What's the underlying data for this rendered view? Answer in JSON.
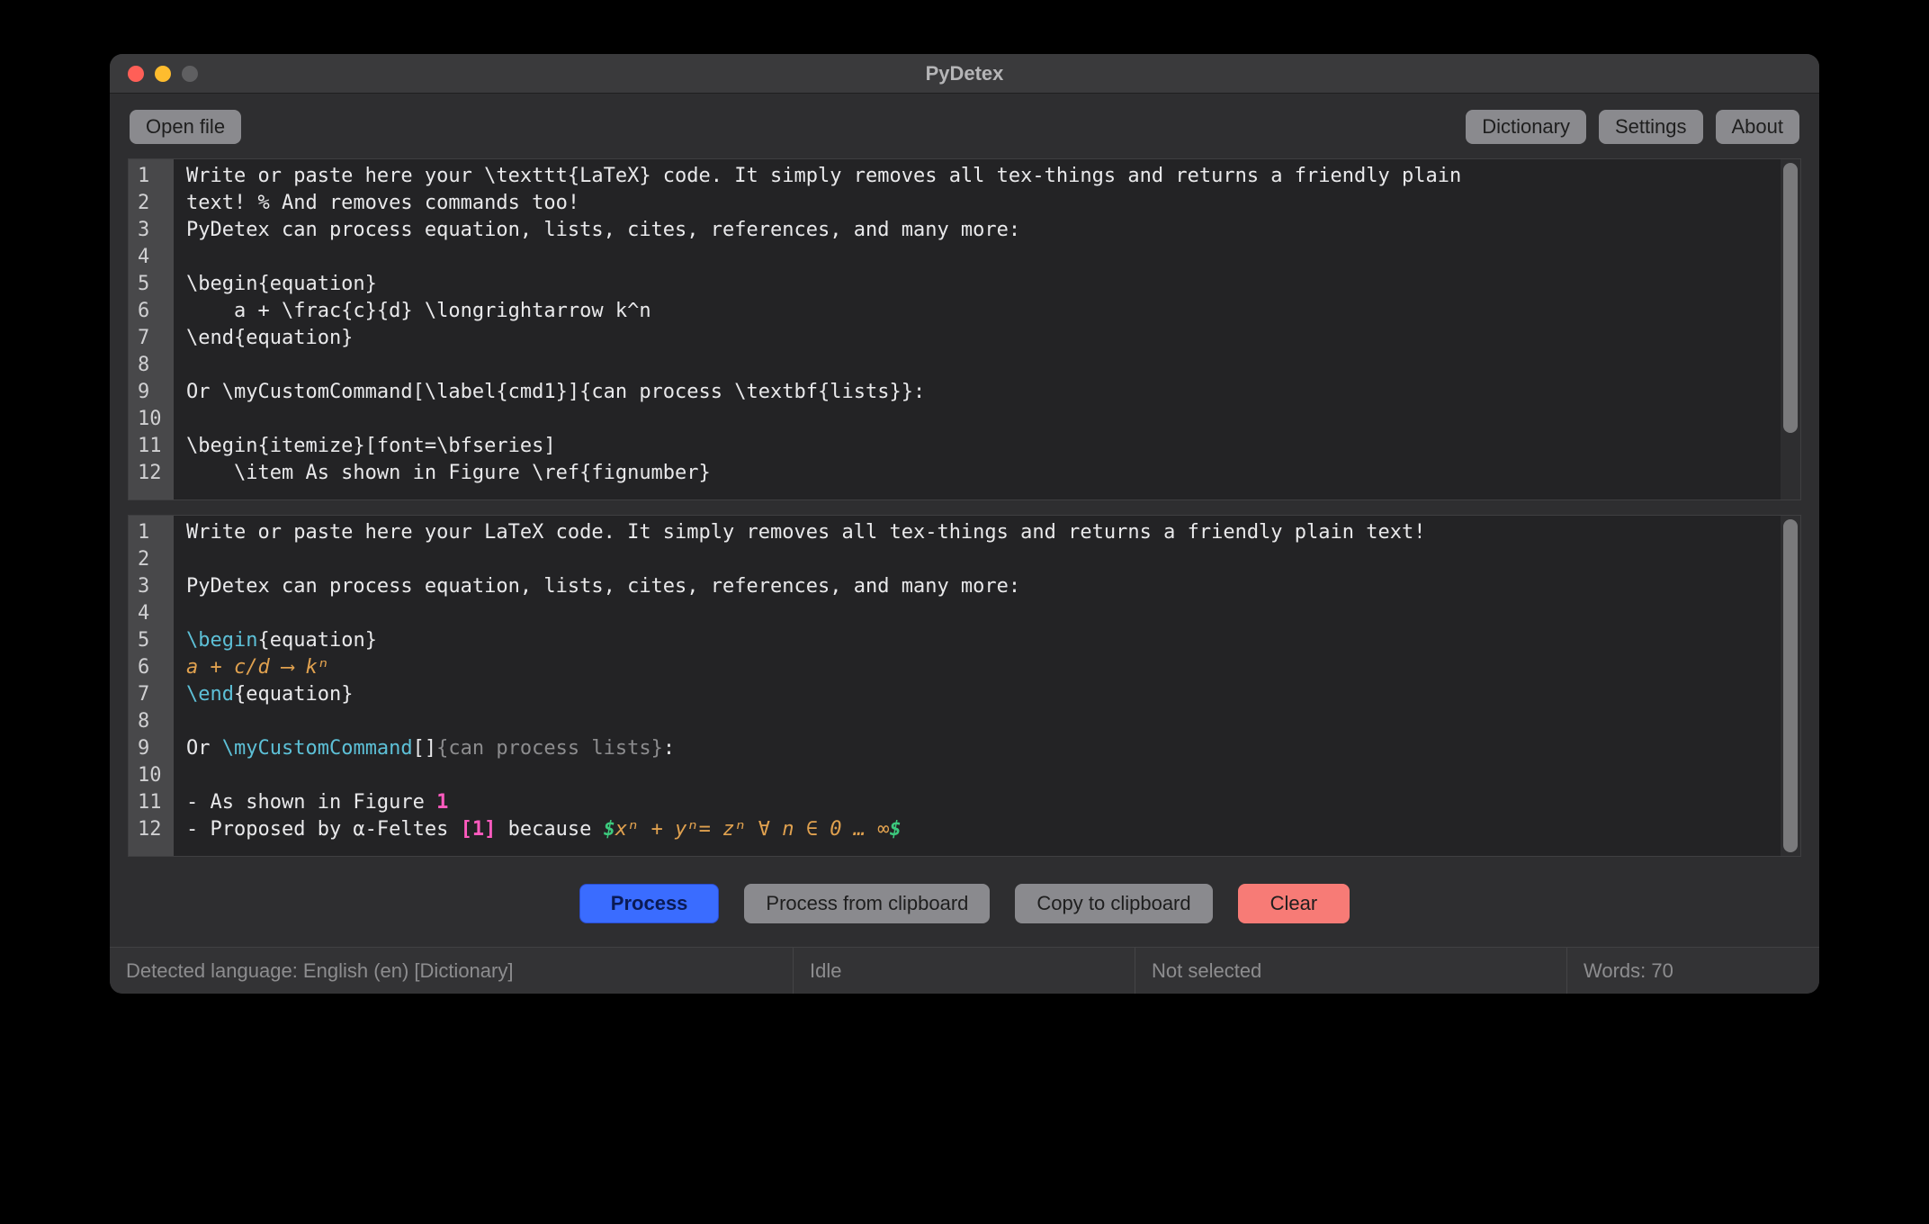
{
  "window": {
    "title": "PyDetex"
  },
  "toolbar": {
    "open_file": "Open file",
    "dictionary": "Dictionary",
    "settings": "Settings",
    "about": "About"
  },
  "editor_top": {
    "line_numbers": [
      "1",
      "2",
      "3",
      "4",
      "5",
      "6",
      "7",
      "8",
      "9",
      "10",
      "11",
      "12"
    ],
    "lines": [
      "Write or paste here your \\texttt{LaTeX} code. It simply removes all tex-things and returns a friendly plain",
      "text! % And removes commands too!",
      "",
      "PyDetex can process equation, lists, cites, references, and many more:",
      "",
      "\\begin{equation}",
      "    a + \\frac{c}{d} \\longrightarrow k^n",
      "\\end{equation}",
      "",
      "Or \\myCustomCommand[\\label{cmd1}]{can process \\textbf{lists}}:",
      "",
      "\\begin{itemize}[font=\\bfseries]",
      "    \\item As shown in Figure \\ref{fignumber}"
    ]
  },
  "editor_bottom": {
    "line_numbers": [
      "1",
      "2",
      "3",
      "4",
      "5",
      "6",
      "7",
      "8",
      "9",
      "10",
      "11",
      "12"
    ],
    "l1": "Write or paste here your LaTeX code. It simply removes all tex-things and returns a friendly plain text!",
    "l3": "PyDetex can process equation, lists, cites, references, and many more:",
    "l5_cmd": "\\begin",
    "l5_rest": "{equation}",
    "l6": "a + c/d ⟶ kⁿ",
    "l7_cmd": "\\end",
    "l7_rest": "{equation}",
    "l9_pre": "Or ",
    "l9_cmd": "\\myCustomCommand",
    "l9_br": "[]",
    "l9_open": "{",
    "l9_txt": "can process lists",
    "l9_close": "}",
    "l9_colon": ":",
    "l11_pre": "- As shown in Figure ",
    "l11_num": "1",
    "l12_pre": "- Proposed by α-Feltes ",
    "l12_cite": "[1]",
    "l12_mid": " because ",
    "l12_d1": "$",
    "l12_eq": "xⁿ + yⁿ= zⁿ ∀ n ∈ 0 … ∞",
    "l12_d2": "$"
  },
  "actions": {
    "process": "Process",
    "process_clipboard": "Process from clipboard",
    "copy_clipboard": "Copy to clipboard",
    "clear": "Clear"
  },
  "status": {
    "language": "Detected language: English (en) [Dictionary]",
    "state": "Idle",
    "selection": "Not selected",
    "words": "Words: 70"
  }
}
